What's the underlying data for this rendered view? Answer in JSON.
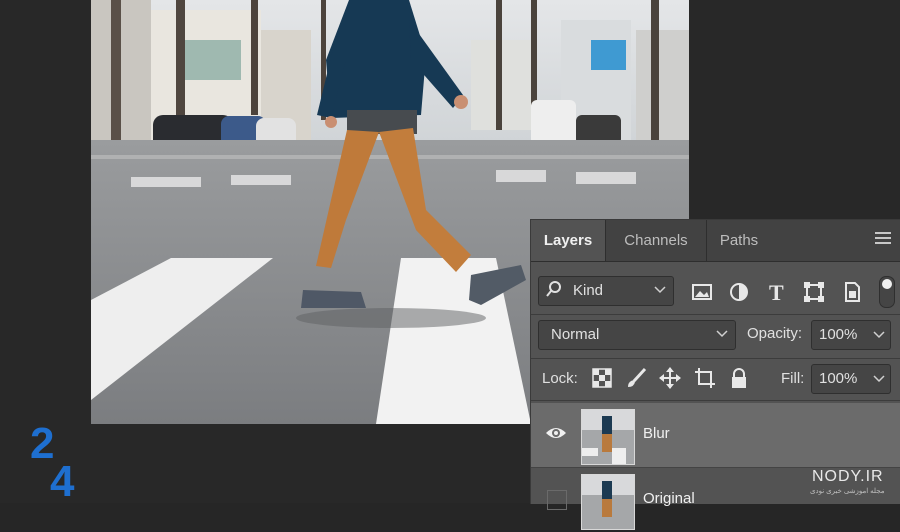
{
  "panel": {
    "tabs": [
      "Layers",
      "Channels",
      "Paths"
    ],
    "filter": {
      "label": "Kind"
    },
    "blend_mode": "Normal",
    "opacity": {
      "label": "Opacity:",
      "value": "100%"
    },
    "lock": {
      "label": "Lock:"
    },
    "fill": {
      "label": "Fill:",
      "value": "100%"
    },
    "layers": [
      {
        "name": "Blur",
        "visible": true,
        "selected": true
      },
      {
        "name": "Original",
        "visible": false,
        "selected": false
      }
    ]
  },
  "watermark": {
    "site": "NODY.IR",
    "tagline": "مجله اموزشی خبری نودی"
  },
  "colors": {
    "panel_bg": "#535353",
    "selected_layer": "#6b6b6b",
    "logo_blue": "#1e6fd0"
  }
}
